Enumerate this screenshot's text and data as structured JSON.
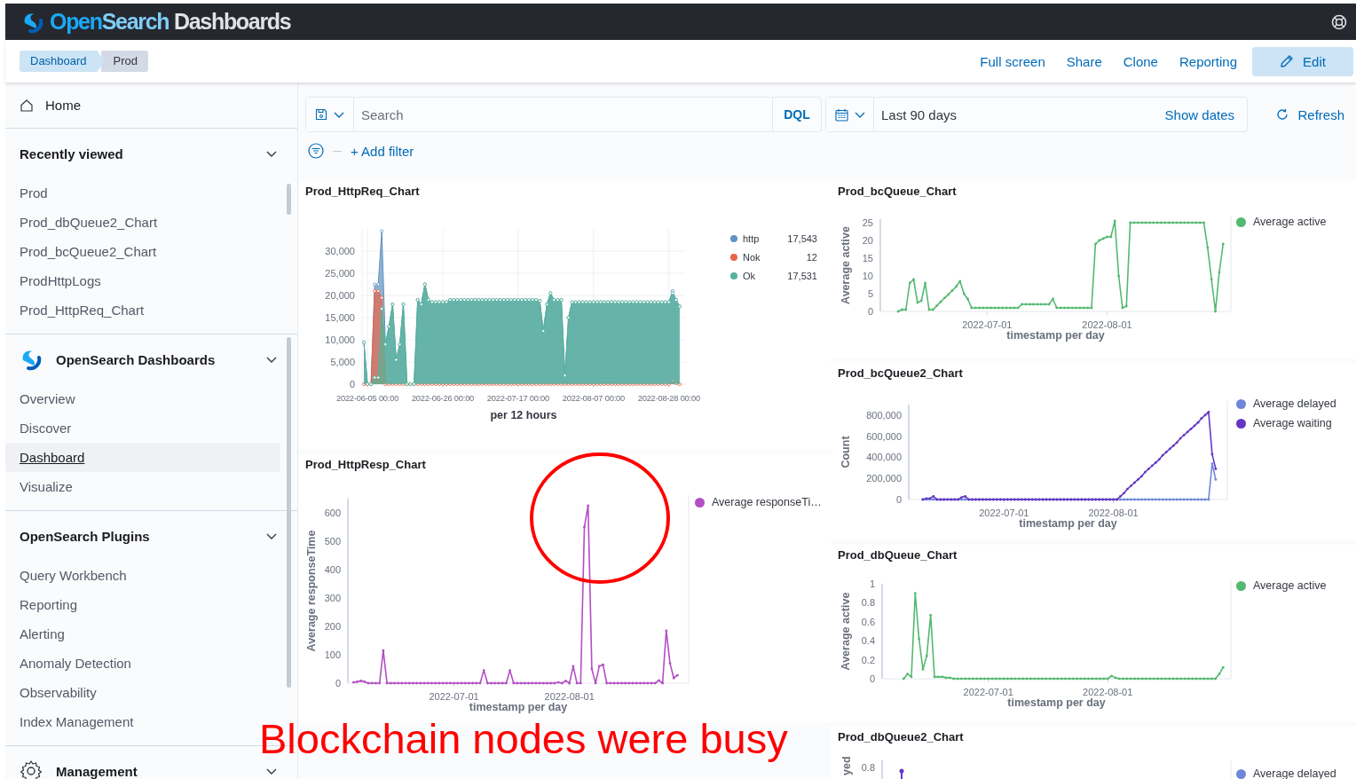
{
  "header": {
    "brand": [
      "Open",
      "Search",
      "Dashboards"
    ]
  },
  "breadcrumbs": [
    {
      "label": "Dashboard",
      "selected": true
    },
    {
      "label": "Prod",
      "selected": false
    }
  ],
  "top_actions": [
    {
      "label": "Full screen",
      "kind": "link"
    },
    {
      "label": "Share",
      "kind": "link"
    },
    {
      "label": "Clone",
      "kind": "link"
    },
    {
      "label": "Reporting",
      "kind": "link"
    },
    {
      "label": "Edit",
      "kind": "primary"
    }
  ],
  "sidebar": {
    "home": "Home",
    "sections": [
      {
        "title": "Recently viewed",
        "expanded": true,
        "items": [
          {
            "label": "Prod",
            "selected": false
          },
          {
            "label": "Prod_dbQueue2_Chart",
            "selected": false
          },
          {
            "label": "Prod_bcQueue2_Chart",
            "selected": false
          },
          {
            "label": "ProdHttpLogs",
            "selected": false
          },
          {
            "label": "Prod_HttpReq_Chart",
            "selected": false
          }
        ]
      },
      {
        "title": "OpenSearch Dashboards",
        "expanded": true,
        "items": [
          {
            "label": "Overview",
            "selected": false
          },
          {
            "label": "Discover",
            "selected": false
          },
          {
            "label": "Dashboard",
            "selected": true
          },
          {
            "label": "Visualize",
            "selected": false
          }
        ]
      },
      {
        "title": "OpenSearch Plugins",
        "expanded": true,
        "items": [
          {
            "label": "Query Workbench",
            "selected": false
          },
          {
            "label": "Reporting",
            "selected": false
          },
          {
            "label": "Alerting",
            "selected": false
          },
          {
            "label": "Anomaly Detection",
            "selected": false
          },
          {
            "label": "Observability",
            "selected": false
          },
          {
            "label": "Index Management",
            "selected": false
          }
        ]
      },
      {
        "title": "Management",
        "expanded": true
      }
    ]
  },
  "query_bar": {
    "placeholder": "Search",
    "language": "DQL",
    "date_range": "Last 90 days",
    "show_dates": "Show dates",
    "refresh": "Refresh",
    "add_filter": "+ Add filter"
  },
  "panels_left": [
    {
      "kind": "chart",
      "title": "Prod_HttpReq_Chart",
      "legend_values": [
        "17,543",
        "12",
        "17,531"
      ],
      "chart_data": {
        "type": "area",
        "grid": true,
        "xlabel": "per 12 hours",
        "ylim": [
          0,
          35000
        ],
        "categories": [
          null,
          "2022-06-05 00:00",
          null,
          null,
          null,
          null,
          null,
          null,
          null,
          null,
          null,
          null,
          null,
          null,
          null,
          null,
          null,
          null,
          null,
          null,
          null,
          null,
          "2022-06-26 00:00",
          null,
          null,
          null,
          null,
          null,
          null,
          null,
          null,
          null,
          null,
          null,
          null,
          null,
          null,
          null,
          null,
          null,
          null,
          null,
          null,
          "2022-07-17 00:00",
          null,
          null,
          null,
          null,
          null,
          null,
          null,
          null,
          null,
          null,
          null,
          null,
          null,
          null,
          null,
          null,
          null,
          null,
          null,
          null,
          "2022-08-07 00:00",
          null,
          null,
          null,
          null,
          null,
          null,
          null,
          null,
          null,
          null,
          null,
          null,
          null,
          null,
          null,
          null,
          null,
          null,
          null,
          null,
          "2022-08-28 00:00",
          null,
          null,
          null,
          null
        ],
        "yticks": [
          {
            "value": 0,
            "label": "0"
          },
          {
            "value": 5000,
            "label": "5,000"
          },
          {
            "value": 10000,
            "label": "10,000"
          },
          {
            "value": 15000,
            "label": "15,000"
          },
          {
            "value": 20000,
            "label": "20,000"
          },
          {
            "value": 25000,
            "label": "25,000"
          },
          {
            "value": 30000,
            "label": "30,000"
          }
        ],
        "series": [
          {
            "name": "http",
            "color": "#6092c0",
            "values": [
              9400,
              0,
              0,
              22500,
              22500,
              34500,
              9000,
              13000,
              18000,
              5500,
              9000,
              18000,
              0,
              0,
              0,
              19000,
              18000,
              22500,
              19000,
              18500,
              18500,
              18500,
              18500,
              18500,
              19000,
              19000,
              19000,
              19000,
              19000,
              19000,
              19000,
              19000,
              19000,
              19000,
              19000,
              19000,
              19000,
              19000,
              19000,
              19000,
              19000,
              19000,
              19000,
              19000,
              19000,
              19000,
              19000,
              19000,
              19000,
              18800,
              12000,
              18000,
              20500,
              19000,
              19000,
              19000,
              2000,
              15000,
              18500,
              18500,
              18500,
              18500,
              18500,
              18500,
              18500,
              18500,
              18500,
              18500,
              18500,
              18500,
              18500,
              18500,
              18500,
              18500,
              18500,
              18500,
              18500,
              18500,
              18500,
              18500,
              18500,
              18500,
              18500,
              18500,
              18500,
              18500,
              21000,
              19000,
              17500,
              null
            ]
          },
          {
            "name": "Nok",
            "color": "#e7664c",
            "values": [
              0,
              0,
              0,
              21000,
              21000,
              19500,
              0,
              0,
              0,
              0,
              0,
              0,
              0,
              0,
              0,
              0,
              0,
              0,
              0,
              0,
              0,
              0,
              0,
              0,
              0,
              0,
              0,
              0,
              0,
              0,
              0,
              0,
              0,
              0,
              0,
              0,
              0,
              0,
              0,
              0,
              0,
              0,
              0,
              0,
              0,
              0,
              0,
              0,
              0,
              0,
              0,
              0,
              0,
              0,
              0,
              0,
              0,
              0,
              0,
              0,
              0,
              0,
              0,
              0,
              0,
              0,
              0,
              0,
              0,
              0,
              0,
              0,
              0,
              0,
              0,
              0,
              0,
              0,
              0,
              0,
              0,
              0,
              0,
              0,
              0,
              0,
              800,
              200,
              0,
              null
            ]
          },
          {
            "name": "Ok",
            "color": "#54b399",
            "values": [
              9400,
              0,
              0,
              1500,
              1500,
              17000,
              9000,
              13000,
              18000,
              5500,
              9000,
              18000,
              0,
              0,
              0,
              19000,
              18000,
              22500,
              19000,
              18500,
              18500,
              18500,
              18500,
              18500,
              19000,
              19000,
              19000,
              19000,
              19000,
              19000,
              19000,
              19000,
              19000,
              19000,
              19000,
              19000,
              19000,
              19000,
              19000,
              19000,
              19000,
              19000,
              19000,
              19000,
              19000,
              19000,
              19000,
              19000,
              19000,
              18800,
              12000,
              18000,
              20500,
              19000,
              19000,
              19000,
              2000,
              15000,
              18500,
              18500,
              18500,
              18500,
              18500,
              18500,
              18500,
              18500,
              18500,
              18500,
              18500,
              18500,
              18500,
              18500,
              18500,
              18500,
              18500,
              18500,
              18500,
              18500,
              18500,
              18500,
              18500,
              18500,
              18500,
              18500,
              18500,
              18500,
              20500,
              19000,
              17500,
              null
            ]
          }
        ]
      }
    },
    {
      "kind": "chart",
      "title": "Prod_HttpResp_Chart",
      "chart_data": {
        "type": "line",
        "xlabel": "timestamp per day",
        "ylabel": "Average responseTime",
        "ylim": [
          0,
          650
        ],
        "categories": [
          null,
          null,
          null,
          null,
          null,
          null,
          null,
          null,
          null,
          null,
          null,
          null,
          null,
          null,
          null,
          null,
          null,
          null,
          null,
          null,
          null,
          null,
          null,
          null,
          null,
          null,
          null,
          "2022-07-01",
          null,
          null,
          null,
          null,
          null,
          null,
          null,
          null,
          null,
          null,
          null,
          null,
          null,
          null,
          null,
          null,
          null,
          null,
          null,
          null,
          null,
          null,
          null,
          null,
          null,
          null,
          null,
          null,
          null,
          null,
          "2022-08-01",
          null,
          null,
          null,
          null,
          null,
          null,
          null,
          null,
          null,
          null,
          null,
          null,
          null,
          null,
          null,
          null,
          null,
          null,
          null,
          null,
          null,
          null,
          null,
          null,
          null,
          null,
          null,
          null,
          null,
          null,
          null
        ],
        "yticks": [
          0,
          100,
          200,
          300,
          400,
          500,
          600
        ],
        "series": [
          {
            "name": "Average responseTi…",
            "color": "#b34fc4",
            "values": [
              3,
              5,
              8,
              5,
              0,
              0,
              0,
              0,
              115,
              0,
              0,
              0,
              0,
              0,
              0,
              0,
              0,
              0,
              0,
              0,
              0,
              0,
              0,
              0,
              0,
              0,
              0,
              0,
              0,
              0,
              0,
              0,
              0,
              0,
              0,
              45,
              0,
              0,
              0,
              0,
              0,
              0,
              45,
              0,
              0,
              0,
              0,
              0,
              0,
              0,
              0,
              0,
              0,
              0,
              0,
              3,
              0,
              8,
              0,
              60,
              0,
              0,
              550,
              625,
              50,
              0,
              60,
              65,
              0,
              0,
              0,
              0,
              0,
              0,
              0,
              0,
              0,
              0,
              0,
              0,
              0,
              0,
              10,
              0,
              185,
              70,
              18,
              28,
              null,
              null
            ]
          }
        ]
      }
    }
  ],
  "panels_right": [
    {
      "kind": "chart",
      "title": "Prod_bcQueue_Chart",
      "chart_data": {
        "type": "line",
        "xlabel": "timestamp per day",
        "ylabel": "Average active",
        "ylim": [
          0,
          26
        ],
        "categories": [
          null,
          null,
          null,
          null,
          null,
          null,
          null,
          null,
          null,
          null,
          null,
          null,
          null,
          null,
          null,
          null,
          null,
          null,
          null,
          null,
          null,
          null,
          null,
          null,
          null,
          null,
          null,
          "2022-07-01",
          null,
          null,
          null,
          null,
          null,
          null,
          null,
          null,
          null,
          null,
          null,
          null,
          null,
          null,
          null,
          null,
          null,
          null,
          null,
          null,
          null,
          null,
          null,
          null,
          null,
          null,
          null,
          null,
          null,
          null,
          "2022-08-01",
          null,
          null,
          null,
          null,
          null,
          null,
          null,
          null,
          null,
          null,
          null,
          null,
          null,
          null,
          null,
          null,
          null,
          null,
          null,
          null,
          null,
          null,
          null,
          null,
          null,
          null,
          null,
          null,
          null,
          null,
          null
        ],
        "yticks": [
          0,
          5,
          10,
          15,
          20,
          25
        ],
        "series": [
          {
            "name": "Average active",
            "color": "#54b970",
            "values": [
              null,
              null,
              null,
              null,
              0,
              0.5,
              0.5,
              8,
              9,
              2.5,
              3,
              8,
              0.5,
              0.5,
              1.6,
              2.7,
              3.8,
              4.8,
              5.9,
              7,
              8.5,
              5,
              3.5,
              1,
              1,
              1,
              1,
              1,
              1,
              1,
              1,
              1,
              1,
              1,
              1,
              1,
              2,
              2,
              2,
              2,
              2,
              2,
              2,
              2,
              3.5,
              1,
              1,
              1,
              1,
              1,
              1,
              1,
              1,
              1,
              1,
              19,
              20,
              20.5,
              21,
              21,
              25.5,
              10,
              1,
              1.5,
              25,
              25,
              25,
              25,
              25,
              25,
              25,
              25,
              25,
              25,
              25,
              25,
              25,
              25,
              25,
              25,
              25,
              25,
              25,
              25,
              18,
              9,
              0,
              11,
              19,
              null
            ]
          }
        ]
      }
    },
    {
      "kind": "chart",
      "title": "Prod_bcQueue2_Chart",
      "chart_data": {
        "type": "line",
        "xlabel": "timestamp per day",
        "ylabel": "Count",
        "ylim": [
          0,
          900000
        ],
        "categories": [
          null,
          null,
          null,
          null,
          null,
          null,
          null,
          null,
          null,
          null,
          null,
          null,
          null,
          null,
          null,
          null,
          null,
          null,
          null,
          null,
          null,
          null,
          null,
          null,
          null,
          null,
          null,
          "2022-07-01",
          null,
          null,
          null,
          null,
          null,
          null,
          null,
          null,
          null,
          null,
          null,
          null,
          null,
          null,
          null,
          null,
          null,
          null,
          null,
          null,
          null,
          null,
          null,
          null,
          null,
          null,
          null,
          null,
          null,
          null,
          "2022-08-01",
          null,
          null,
          null,
          null,
          null,
          null,
          null,
          null,
          null,
          null,
          null,
          null,
          null,
          null,
          null,
          null,
          null,
          null,
          null,
          null,
          null,
          null,
          null,
          null,
          null,
          null,
          null,
          null,
          null,
          null,
          null
        ],
        "yticks": [
          {
            "value": 0,
            "label": "0"
          },
          {
            "value": 200000,
            "label": "200,000"
          },
          {
            "value": 400000,
            "label": "400,000"
          },
          {
            "value": 600000,
            "label": "600,000"
          },
          {
            "value": 800000,
            "label": "800,000"
          }
        ],
        "series": [
          {
            "name": "Average delayed",
            "color": "#6f87d8",
            "values": [
              null,
              null,
              null,
              null,
              0,
              0,
              0,
              0,
              0,
              0,
              0,
              0,
              0,
              0,
              0,
              0,
              0,
              0,
              0,
              0,
              0,
              0,
              0,
              0,
              0,
              0,
              0,
              0,
              0,
              0,
              0,
              0,
              0,
              0,
              0,
              0,
              0,
              0,
              0,
              0,
              0,
              0,
              0,
              0,
              0,
              0,
              0,
              0,
              0,
              0,
              0,
              0,
              0,
              0,
              0,
              0,
              0,
              0,
              0,
              0,
              0,
              0,
              0,
              0,
              0,
              0,
              0,
              0,
              0,
              0,
              0,
              0,
              0,
              0,
              0,
              0,
              0,
              0,
              0,
              0,
              0,
              0,
              0,
              0,
              0,
              0,
              340000,
              190000,
              null,
              null
            ]
          },
          {
            "name": "Average waiting",
            "color": "#6438c4",
            "values": [
              null,
              null,
              null,
              null,
              0,
              10000,
              10000,
              30000,
              0,
              0,
              0,
              0,
              0,
              0,
              0,
              20000,
              30000,
              0,
              0,
              0,
              0,
              0,
              0,
              0,
              0,
              0,
              0,
              0,
              0,
              0,
              0,
              0,
              0,
              0,
              0,
              0,
              0,
              0,
              0,
              0,
              0,
              0,
              0,
              0,
              0,
              0,
              0,
              0,
              0,
              0,
              0,
              0,
              0,
              0,
              0,
              0,
              0,
              0,
              0,
              0,
              30000,
              60000,
              100000,
              130000,
              160000,
              190000,
              220000,
              260000,
              290000,
              320000,
              350000,
              380000,
              420000,
              450000,
              480000,
              510000,
              540000,
              580000,
              610000,
              640000,
              670000,
              700000,
              730000,
              770000,
              800000,
              830000,
              430000,
              290000,
              null,
              null
            ]
          }
        ]
      }
    },
    {
      "kind": "chart",
      "title": "Prod_dbQueue_Chart",
      "chart_data": {
        "type": "line",
        "xlabel": "timestamp per day",
        "ylabel": "Average active",
        "ylim": [
          0,
          1
        ],
        "categories": [
          null,
          null,
          null,
          null,
          null,
          null,
          null,
          null,
          null,
          null,
          null,
          null,
          null,
          null,
          null,
          null,
          null,
          null,
          null,
          null,
          null,
          null,
          null,
          null,
          null,
          null,
          null,
          "2022-07-01",
          null,
          null,
          null,
          null,
          null,
          null,
          null,
          null,
          null,
          null,
          null,
          null,
          null,
          null,
          null,
          null,
          null,
          null,
          null,
          null,
          null,
          null,
          null,
          null,
          null,
          null,
          null,
          null,
          null,
          null,
          "2022-08-01",
          null,
          null,
          null,
          null,
          null,
          null,
          null,
          null,
          null,
          null,
          null,
          null,
          null,
          null,
          null,
          null,
          null,
          null,
          null,
          null,
          null,
          null,
          null,
          null,
          null,
          null,
          null,
          null,
          null,
          null,
          null
        ],
        "yticks": [
          0,
          0.2,
          0.4,
          0.6,
          0.8,
          1
        ],
        "series": [
          {
            "name": "Average active",
            "color": "#54b970",
            "values": [
              null,
              null,
              null,
              null,
              null,
              0,
              0.05,
              0.02,
              0.9,
              0.42,
              0.1,
              0.24,
              0.67,
              0.02,
              0.02,
              0.02,
              0.01,
              0.01,
              0,
              0,
              0,
              0,
              0,
              0,
              0,
              0,
              0,
              0,
              0,
              0,
              0,
              0,
              0,
              0,
              0,
              0,
              0,
              0,
              0,
              0,
              0,
              0,
              0,
              0,
              0,
              0,
              0,
              0,
              0,
              0,
              0,
              0,
              0,
              0,
              0,
              0,
              0,
              0,
              0,
              0.03,
              0.01,
              0,
              0,
              0,
              0,
              0,
              0,
              0,
              0,
              0,
              0,
              0,
              0,
              0,
              0,
              0,
              0,
              0,
              0,
              0,
              0,
              0,
              0,
              0,
              0,
              0,
              0,
              0.05,
              0.12,
              null
            ]
          }
        ]
      }
    },
    {
      "kind": "partial",
      "title": "Prod_dbQueue2_Chart",
      "ylabel": "yed",
      "ytick": "0.8",
      "legend": [
        {
          "name": "Average delayed",
          "color": "#6f87d8"
        }
      ]
    }
  ],
  "annotations": [
    {
      "kind": "circle"
    },
    {
      "kind": "text",
      "text": "Blockchain nodes were busy"
    }
  ]
}
